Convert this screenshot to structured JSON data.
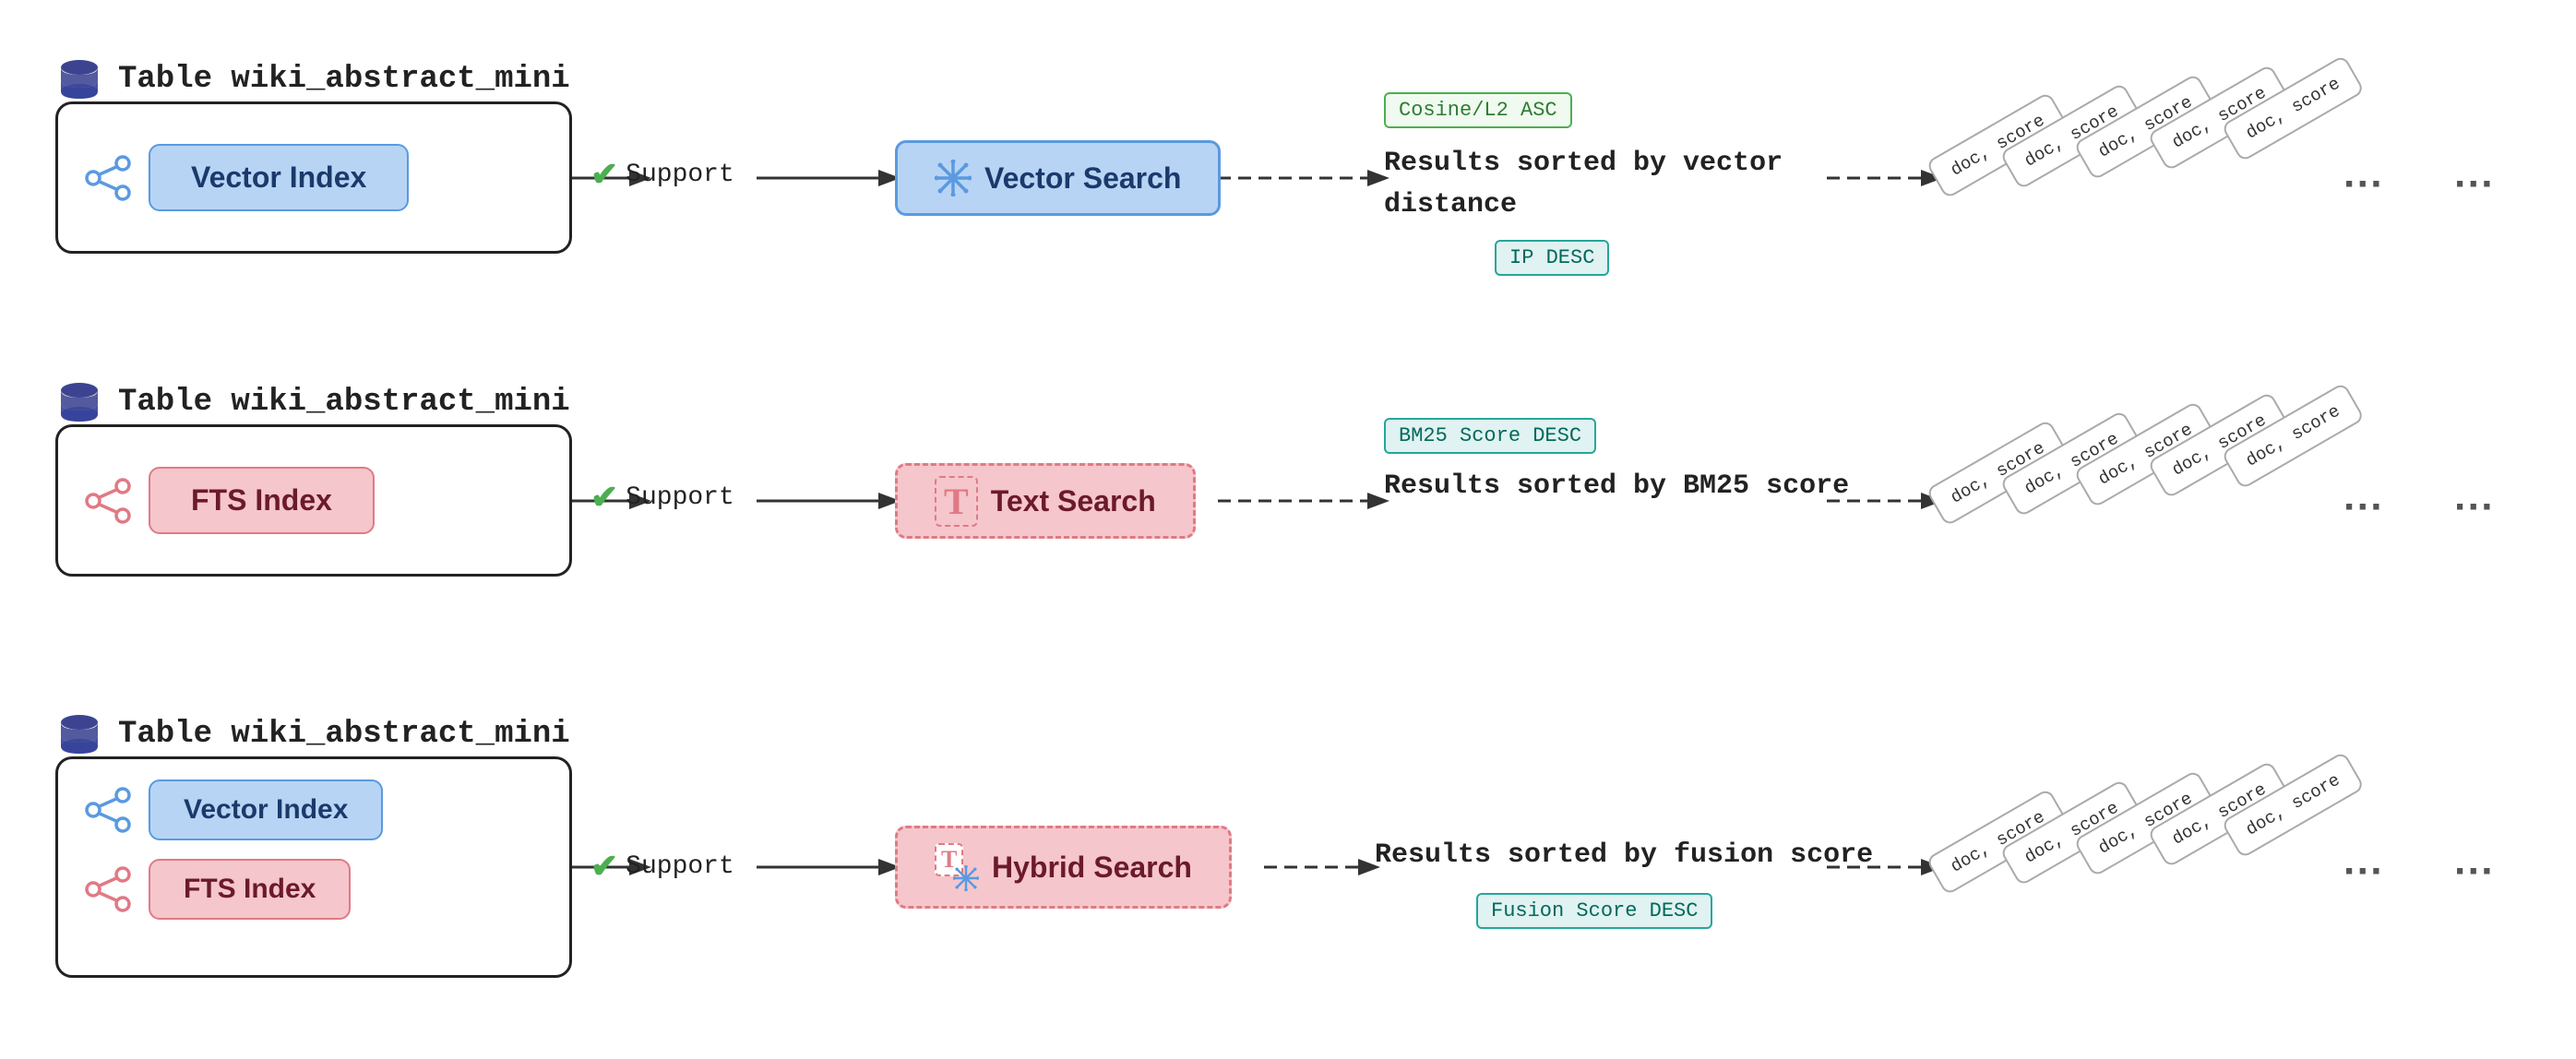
{
  "rows": [
    {
      "id": "row1",
      "table_label": "Table wiki_abstract_mini",
      "index_items": [
        {
          "label": "Vector Index",
          "type": "blue"
        }
      ],
      "search_label": "Vector Search",
      "search_type": "blue",
      "search_icon": "snowflake",
      "result_text": "Results sorted by vector\n        distance",
      "score_tags": [
        "Cosine/L2 ASC",
        "IP DESC"
      ],
      "score_tag_types": [
        "green",
        "teal"
      ],
      "doc_label": "doc, score"
    },
    {
      "id": "row2",
      "table_label": "Table wiki_abstract_mini",
      "index_items": [
        {
          "label": "FTS Index",
          "type": "pink"
        }
      ],
      "search_label": "Text Search",
      "search_type": "pink",
      "search_icon": "T",
      "result_text": "Results sorted by BM25 score",
      "score_tags": [
        "BM25 Score DESC"
      ],
      "score_tag_types": [
        "teal"
      ],
      "doc_label": "doc, score"
    },
    {
      "id": "row3",
      "table_label": "Table wiki_abstract_mini",
      "index_items": [
        {
          "label": "Vector Index",
          "type": "blue"
        },
        {
          "label": "FTS Index",
          "type": "pink"
        }
      ],
      "search_label": "Hybrid Search",
      "search_type": "hybrid",
      "search_icon": "both",
      "result_text": "Results sorted by fusion score",
      "score_tags": [
        "Fusion Score DESC"
      ],
      "score_tag_types": [
        "teal"
      ],
      "doc_label": "doc, score"
    }
  ],
  "support_label": "Support",
  "ellipsis": "...",
  "doc_card_label": "doc, score"
}
